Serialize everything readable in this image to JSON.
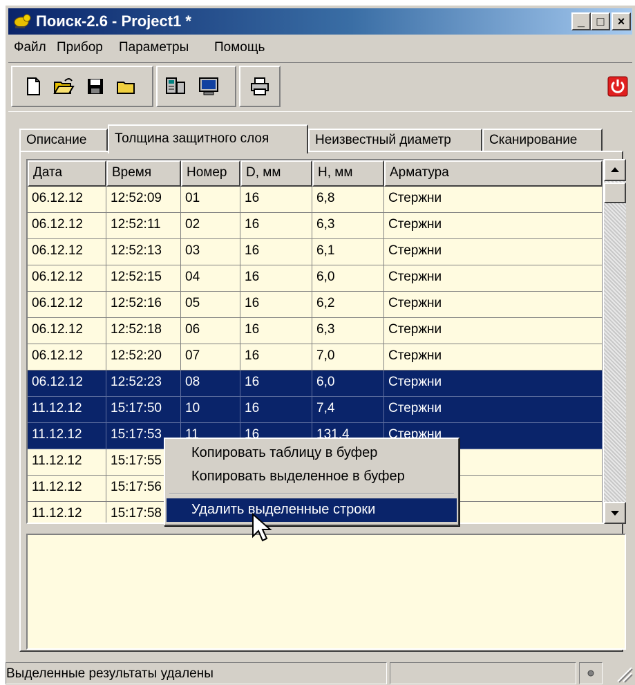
{
  "window": {
    "title": "Поиск-2.6 - Project1 *",
    "controls": {
      "minimize": "_",
      "maximize": "□",
      "close": "×"
    }
  },
  "menu": [
    "Файл",
    "Прибор",
    "Параметры",
    "Помощь"
  ],
  "toolbar": {
    "icons": [
      "new-file-icon",
      "open-folder-icon",
      "save-icon",
      "folder-icon",
      "device-icon",
      "monitor-icon",
      "print-icon",
      "power-icon"
    ]
  },
  "tabs": [
    {
      "label": "Описание",
      "active": false
    },
    {
      "label": "Толщина защитного слоя",
      "active": true
    },
    {
      "label": "Неизвестный диаметр",
      "active": false
    },
    {
      "label": "Сканирование",
      "active": false
    }
  ],
  "table": {
    "columns": [
      "Дата",
      "Время",
      "Номер",
      "D, мм",
      "H, мм",
      "Арматура"
    ],
    "rows": [
      {
        "cells": [
          "06.12.12",
          "12:52:09",
          "01",
          "16",
          "6,8",
          "Стержни"
        ],
        "selected": false
      },
      {
        "cells": [
          "06.12.12",
          "12:52:11",
          "02",
          "16",
          "6,3",
          "Стержни"
        ],
        "selected": false
      },
      {
        "cells": [
          "06.12.12",
          "12:52:13",
          "03",
          "16",
          "6,1",
          "Стержни"
        ],
        "selected": false
      },
      {
        "cells": [
          "06.12.12",
          "12:52:15",
          "04",
          "16",
          "6,0",
          "Стержни"
        ],
        "selected": false
      },
      {
        "cells": [
          "06.12.12",
          "12:52:16",
          "05",
          "16",
          "6,2",
          "Стержни"
        ],
        "selected": false
      },
      {
        "cells": [
          "06.12.12",
          "12:52:18",
          "06",
          "16",
          "6,3",
          "Стержни"
        ],
        "selected": false
      },
      {
        "cells": [
          "06.12.12",
          "12:52:20",
          "07",
          "16",
          "7,0",
          "Стержни"
        ],
        "selected": false
      },
      {
        "cells": [
          "06.12.12",
          "12:52:23",
          "08",
          "16",
          "6,0",
          "Стержни"
        ],
        "selected": true
      },
      {
        "cells": [
          "11.12.12",
          "15:17:50",
          "10",
          "16",
          "7,4",
          "Стержни"
        ],
        "selected": true
      },
      {
        "cells": [
          "11.12.12",
          "15:17:53",
          "11",
          "16",
          "131,4",
          "Стержни"
        ],
        "selected": true
      },
      {
        "cells": [
          "11.12.12",
          "15:17:55",
          "",
          "",
          "",
          ""
        ],
        "selected": false
      },
      {
        "cells": [
          "11.12.12",
          "15:17:56",
          "",
          "",
          "",
          ""
        ],
        "selected": false
      },
      {
        "cells": [
          "11.12.12",
          "15:17:58",
          "",
          "",
          "",
          ""
        ],
        "selected": false
      }
    ]
  },
  "context_menu": {
    "items": [
      {
        "label": "Копировать таблицу в буфер",
        "highlighted": false
      },
      {
        "label": "Копировать выделенное в буфер",
        "highlighted": false
      },
      {
        "label": "Удалить выделенные строки",
        "highlighted": true
      }
    ]
  },
  "status": {
    "message": "Выделенные результаты удалены",
    "panel2": "",
    "indicator_icon": "status-dot-icon"
  },
  "colors": {
    "selection": "#0a246a",
    "grid_bg": "#fffbe0",
    "face": "#d4d0c8"
  }
}
